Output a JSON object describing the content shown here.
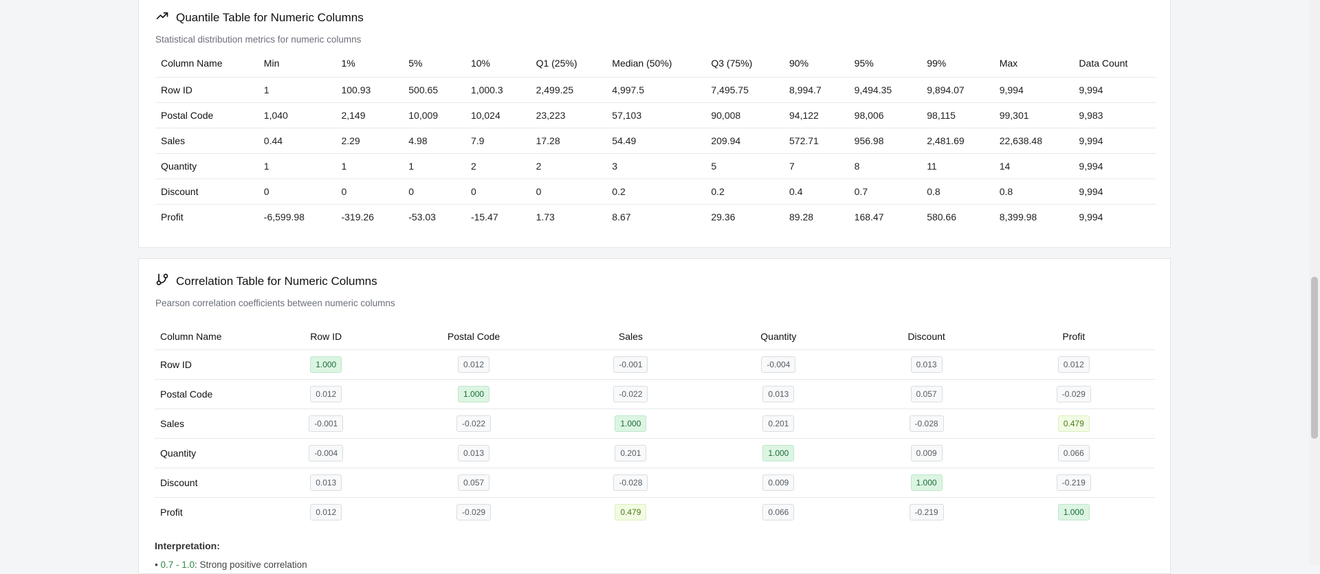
{
  "quantile": {
    "title": "Quantile Table for Numeric Columns",
    "subtitle": "Statistical distribution metrics for numeric columns",
    "icon": "trending-up-icon",
    "headers": [
      "Column Name",
      "Min",
      "1%",
      "5%",
      "10%",
      "Q1 (25%)",
      "Median (50%)",
      "Q3 (75%)",
      "90%",
      "95%",
      "99%",
      "Max",
      "Data Count"
    ],
    "rows": [
      [
        "Row ID",
        "1",
        "100.93",
        "500.65",
        "1,000.3",
        "2,499.25",
        "4,997.5",
        "7,495.75",
        "8,994.7",
        "9,494.35",
        "9,894.07",
        "9,994",
        "9,994"
      ],
      [
        "Postal Code",
        "1,040",
        "2,149",
        "10,009",
        "10,024",
        "23,223",
        "57,103",
        "90,008",
        "94,122",
        "98,006",
        "98,115",
        "99,301",
        "9,983"
      ],
      [
        "Sales",
        "0.44",
        "2.29",
        "4.98",
        "7.9",
        "17.28",
        "54.49",
        "209.94",
        "572.71",
        "956.98",
        "2,481.69",
        "22,638.48",
        "9,994"
      ],
      [
        "Quantity",
        "1",
        "1",
        "1",
        "2",
        "2",
        "3",
        "5",
        "7",
        "8",
        "11",
        "14",
        "9,994"
      ],
      [
        "Discount",
        "0",
        "0",
        "0",
        "0",
        "0",
        "0.2",
        "0.2",
        "0.4",
        "0.7",
        "0.8",
        "0.8",
        "9,994"
      ],
      [
        "Profit",
        "-6,599.98",
        "-319.26",
        "-53.03",
        "-15.47",
        "1.73",
        "8.67",
        "29.36",
        "89.28",
        "168.47",
        "580.66",
        "8,399.98",
        "9,994"
      ]
    ]
  },
  "correlation": {
    "title": "Correlation Table for Numeric Columns",
    "subtitle": "Pearson correlation coefficients between numeric columns",
    "icon": "git-branch-icon",
    "headers": [
      "Column Name",
      "Row ID",
      "Postal Code",
      "Sales",
      "Quantity",
      "Discount",
      "Profit"
    ],
    "rows": [
      [
        "Row ID",
        "1.000",
        "0.012",
        "-0.001",
        "-0.004",
        "0.013",
        "0.012"
      ],
      [
        "Postal Code",
        "0.012",
        "1.000",
        "-0.022",
        "0.013",
        "0.057",
        "-0.029"
      ],
      [
        "Sales",
        "-0.001",
        "-0.022",
        "1.000",
        "0.201",
        "-0.028",
        "0.479"
      ],
      [
        "Quantity",
        "-0.004",
        "0.013",
        "0.201",
        "1.000",
        "0.009",
        "0.066"
      ],
      [
        "Discount",
        "0.013",
        "0.057",
        "-0.028",
        "0.009",
        "1.000",
        "-0.219"
      ],
      [
        "Profit",
        "0.012",
        "-0.029",
        "0.479",
        "0.066",
        "-0.219",
        "1.000"
      ]
    ],
    "interpretation_label": "Interpretation:",
    "legend": {
      "range": "0.7 - 1.0",
      "text": ": Strong positive correlation"
    }
  },
  "colors": {
    "strong": "#dcf5e3",
    "moderate": "#f2fbe3",
    "neutral": "#f8f9fa"
  }
}
